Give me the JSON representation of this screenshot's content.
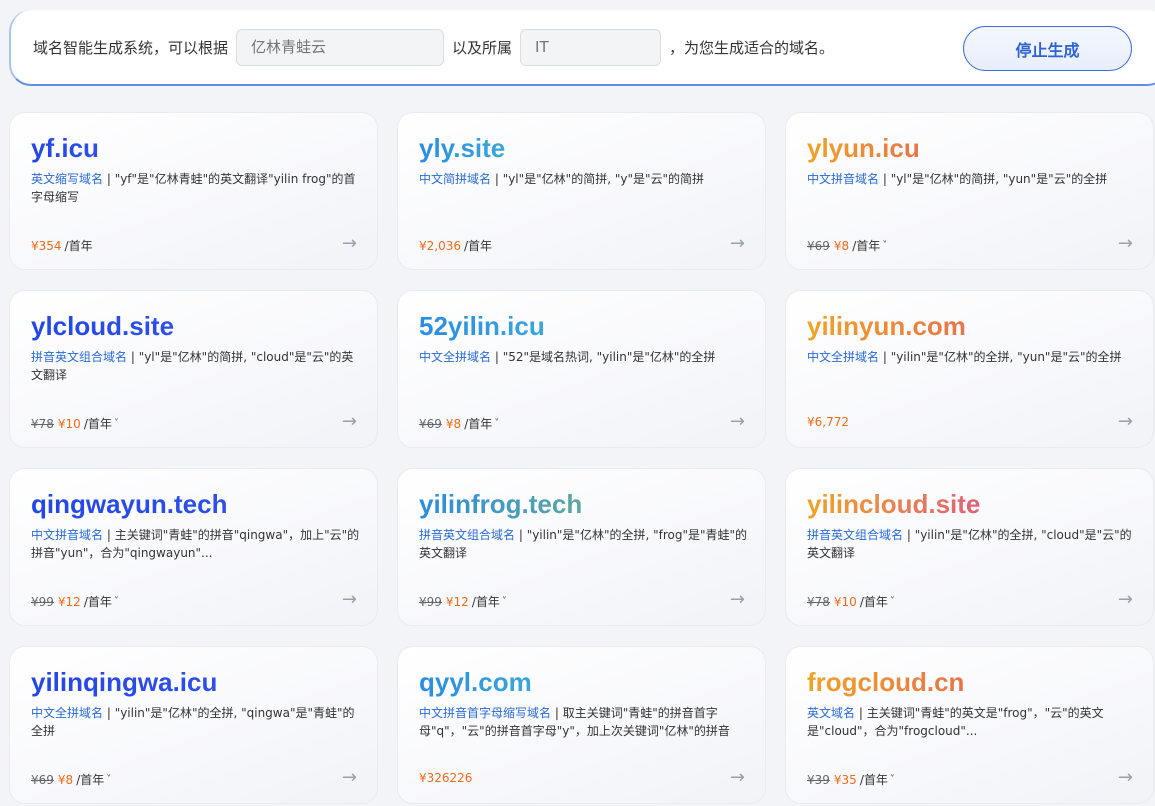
{
  "header": {
    "prefix_text": "域名智能生成系统，可以根据",
    "keyword_placeholder": "亿林青蛙云",
    "middle_text": "以及所属",
    "industry_placeholder": "IT",
    "suffix_text": "，为您生成适合的域名。",
    "stop_button_label": "停止生成"
  },
  "cards": [
    {
      "domain": "yf.icu",
      "style": "g-blue",
      "tag": "英文缩写域名",
      "desc": " | \"yf\"是\"亿林青蛙\"的英文翻译\"yilin frog\"的首字母缩写",
      "old_price": "",
      "price": "¥354",
      "unit": "/首年",
      "has_dropdown": false
    },
    {
      "domain": "yly.site",
      "style": "g-sky",
      "tag": "中文简拼域名",
      "desc": " | \"yl\"是\"亿林\"的简拼, \"y\"是\"云\"的简拼",
      "old_price": "",
      "price": "¥2,036",
      "unit": "/首年",
      "has_dropdown": false
    },
    {
      "domain": "ylyun.icu",
      "style": "g-orange",
      "tag": "中文拼音域名",
      "desc": " | \"yl\"是\"亿林\"的简拼, \"yun\"是\"云\"的全拼",
      "old_price": "¥69",
      "price": "¥8",
      "unit": "/首年",
      "has_dropdown": true
    },
    {
      "domain": "ylcloud.site",
      "style": "g-blue",
      "tag": "拼音英文组合域名",
      "desc": " | \"yl\"是\"亿林\"的简拼, \"cloud\"是\"云\"的英文翻译",
      "old_price": "¥78",
      "price": "¥10",
      "unit": "/首年",
      "has_dropdown": true
    },
    {
      "domain": "52yilin.icu",
      "style": "g-sky",
      "tag": "中文全拼域名",
      "desc": " | \"52\"是域名热词, \"yilin\"是\"亿林\"的全拼",
      "old_price": "¥69",
      "price": "¥8",
      "unit": "/首年",
      "has_dropdown": true
    },
    {
      "domain": "yilinyun.com",
      "style": "g-orange",
      "tag": "中文全拼域名",
      "desc": " | \"yilin\"是\"亿林\"的全拼, \"yun\"是\"云\"的全拼",
      "old_price": "",
      "price": "¥6,772",
      "unit": "",
      "has_dropdown": false
    },
    {
      "domain": "qingwayun.tech",
      "style": "g-blue",
      "tag": "中文拼音域名",
      "desc": " | 主关键词\"青蛙\"的拼音\"qingwa\"，加上\"云\"的拼音\"yun\"，合为\"qingwayun\"...",
      "old_price": "¥99",
      "price": "¥12",
      "unit": "/首年",
      "has_dropdown": true
    },
    {
      "domain": "yilinfrog.tech",
      "style": "g-teal",
      "tag": "拼音英文组合域名",
      "desc": " | \"yilin\"是\"亿林\"的全拼, \"frog\"是\"青蛙\"的英文翻译",
      "old_price": "¥99",
      "price": "¥12",
      "unit": "/首年",
      "has_dropdown": true
    },
    {
      "domain": "yilincloud.site",
      "style": "g-warm",
      "tag": "拼音英文组合域名",
      "desc": " | \"yilin\"是\"亿林\"的全拼, \"cloud\"是\"云\"的英文翻译",
      "old_price": "¥78",
      "price": "¥10",
      "unit": "/首年",
      "has_dropdown": true
    },
    {
      "domain": "yilinqingwa.icu",
      "style": "g-blue",
      "tag": "中文全拼域名",
      "desc": " | \"yilin\"是\"亿林\"的全拼, \"qingwa\"是\"青蛙\"的全拼",
      "old_price": "¥69",
      "price": "¥8",
      "unit": "/首年",
      "has_dropdown": true
    },
    {
      "domain": "qyyl.com",
      "style": "g-sky",
      "tag": "中文拼音首字母缩写域名",
      "desc": " | 取主关键词\"青蛙\"的拼音首字母\"q\"，\"云\"的拼音首字母\"y\"，加上次关键词\"亿林\"的拼音首...",
      "old_price": "",
      "price": "¥326226",
      "unit": "",
      "has_dropdown": false
    },
    {
      "domain": "frogcloud.cn",
      "style": "g-orange",
      "tag": "英文域名",
      "desc": " | 主关键词\"青蛙\"的英文是\"frog\"，\"云\"的英文是\"cloud\"，合为\"frogcloud\"...",
      "old_price": "¥39",
      "price": "¥35",
      "unit": "/首年",
      "has_dropdown": true
    }
  ],
  "icons": {
    "arrow": "arrow-right-icon",
    "dropdown": "chevron-down-icon"
  }
}
